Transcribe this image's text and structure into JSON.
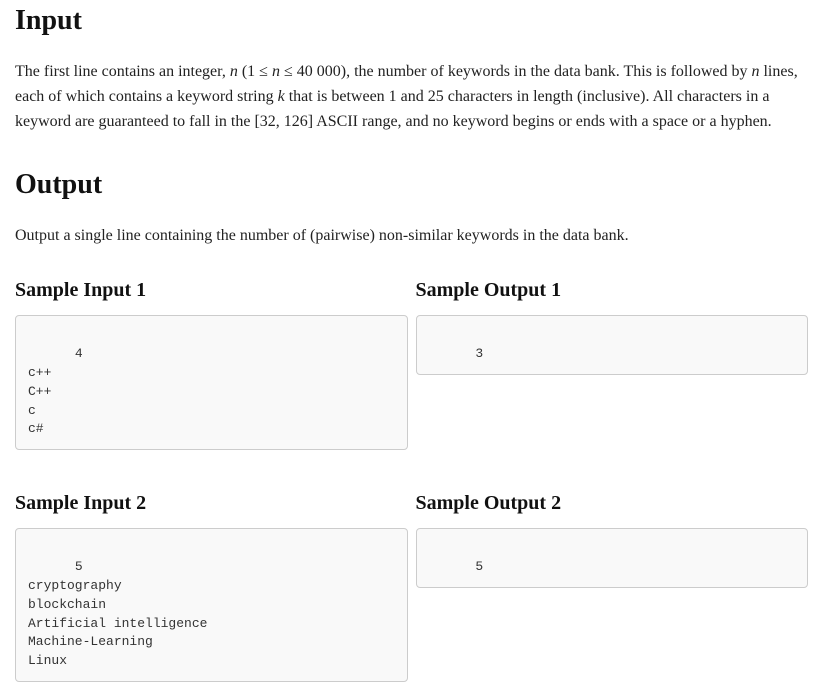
{
  "input": {
    "heading": "Input",
    "para_prefix": "The first line contains an integer, ",
    "n": "n",
    "open_paren": " (",
    "one": "1",
    "leq1": " ≤ ",
    "n2": "n",
    "leq2": " ≤ ",
    "forty_k": "40 000",
    "close_paren": "), the number of keywords in the data bank. This is followed by ",
    "n3": "n",
    "mid": " lines, each of which contains a keyword string ",
    "k": "k",
    "between": " that is between ",
    "one2": "1",
    "and": " and ",
    "twentyfive": "25",
    "afterlen": " characters in length (inclusive). All characters in a keyword are guaranteed to fall in the ",
    "range": "[32, 126]",
    "tail": " ASCII range, and no keyword begins or ends with a space or a hyphen."
  },
  "output": {
    "heading": "Output",
    "text": "Output a single line containing the number of (pairwise) non-similar keywords in the data bank."
  },
  "samples": [
    {
      "in_heading": "Sample Input 1",
      "out_heading": "Sample Output 1",
      "input": "4\nc++\nC++\nc\nc#",
      "output": "3"
    },
    {
      "in_heading": "Sample Input 2",
      "out_heading": "Sample Output 2",
      "input": "5\ncryptography\nblockchain\nArtificial intelligence\nMachine-Learning\nLinux",
      "output": "5"
    }
  ]
}
